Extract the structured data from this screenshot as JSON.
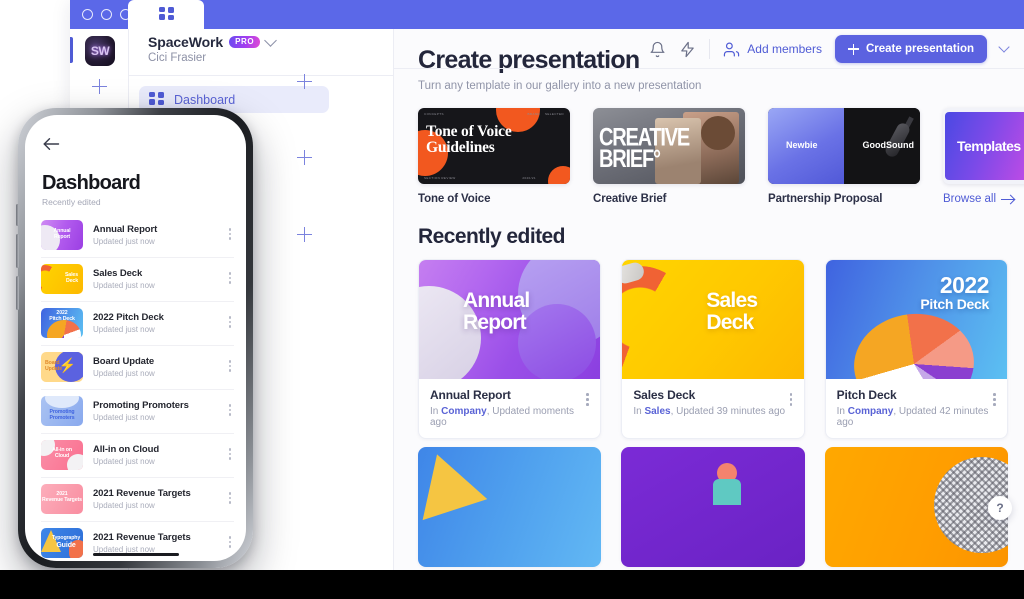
{
  "browser": {
    "tab_icon": "grid-icon",
    "traffic_lights": [
      "close",
      "minimize",
      "maximize"
    ]
  },
  "workspace": {
    "avatar_initials": "SW",
    "name": "SpaceWork",
    "plan_badge": "PRO",
    "user": "Cici Frasier",
    "chevron_icon": "chevron-down-icon",
    "rail_add_icon": "plus-icon",
    "sidebar_add_icon": "plus-icon"
  },
  "sidebar": {
    "items": [
      {
        "label": "Dashboard",
        "icon": "grid-icon",
        "active": true
      }
    ]
  },
  "appbar": {
    "notifications_icon": "bell-icon",
    "activity_icon": "lightning-icon",
    "add_members_icon": "people-icon",
    "add_members_label": "Add members",
    "create_label": "Create presentation",
    "create_plus_icon": "plus-icon",
    "create_chevron_icon": "chevron-down-icon",
    "accent": "#5b62e0"
  },
  "main": {
    "title": "Create presentation",
    "subtitle": "Turn any template in our gallery into a new presentation",
    "templates": [
      {
        "name": "Tone of Voice",
        "art": "tone-of-voice",
        "thumb_line1": "Tone of Voice",
        "thumb_line2": "Guidelines"
      },
      {
        "name": "Creative Brief",
        "art": "creative-brief",
        "thumb_line1": "CREATIVE",
        "thumb_line2": "BRIEF°"
      },
      {
        "name": "Partnership Proposal",
        "art": "partnership",
        "thumb_line1": "Newbie",
        "thumb_line2": "GoodSound"
      },
      {
        "name": "Browse all",
        "art": "templates-stack",
        "thumb_line1": "Templates",
        "is_link": true,
        "arrow_icon": "arrow-right-icon"
      }
    ],
    "recent_title": "Recently edited",
    "recent_cards": [
      {
        "title": "Annual Report",
        "meta_prefix": "In ",
        "meta_folder": "Company",
        "meta_suffix": ", Updated moments ago",
        "thumb_line1": "Annual",
        "thumb_line2": "Report",
        "art": "annual-report",
        "menu_icon": "kebab-menu-icon"
      },
      {
        "title": "Sales Deck",
        "meta_prefix": "In ",
        "meta_folder": "Sales",
        "meta_suffix": ", Updated 39 minutes ago",
        "thumb_line1": "Sales",
        "thumb_line2": "Deck",
        "art": "sales-deck",
        "menu_icon": "kebab-menu-icon"
      },
      {
        "title": "Pitch Deck",
        "meta_prefix": "In ",
        "meta_folder": "Company",
        "meta_suffix": ", Updated 42 minutes ago",
        "thumb_line1": "2022",
        "thumb_line2": "Pitch Deck",
        "art": "pitch-deck",
        "menu_icon": "kebab-menu-icon"
      }
    ],
    "recent_cards_row2": [
      {
        "art": "typography-guide"
      },
      {
        "art": "purple-character"
      },
      {
        "art": "orange-sphere"
      }
    ],
    "help_label": "?"
  },
  "phone": {
    "back_icon": "arrow-left-icon",
    "title": "Dashboard",
    "subtitle": "Recently edited",
    "items": [
      {
        "name": "Annual Report",
        "meta": "Updated just now",
        "art": "ph-a",
        "thumb_label": "Annual\nReport",
        "menu_icon": "kebab-menu-icon"
      },
      {
        "name": "Sales Deck",
        "meta": "Updated just now",
        "art": "ph-b",
        "thumb_label": "Sales\nDeck",
        "menu_icon": "kebab-menu-icon"
      },
      {
        "name": "2022 Pitch Deck",
        "meta": "Updated just now",
        "art": "ph-c",
        "thumb_label": "2022\nPitch Deck",
        "menu_icon": "kebab-menu-icon"
      },
      {
        "name": "Board Update",
        "meta": "Updated just now",
        "art": "ph-d",
        "thumb_label": "Board\nUpdate",
        "menu_icon": "kebab-menu-icon"
      },
      {
        "name": "Promoting Promoters",
        "meta": "Updated just now",
        "art": "ph-e",
        "thumb_label": "Promoting\nPromoters",
        "menu_icon": "kebab-menu-icon"
      },
      {
        "name": "All-in on Cloud",
        "meta": "Updated just now",
        "art": "ph-f",
        "thumb_label": "All-in on\nCloud",
        "menu_icon": "kebab-menu-icon"
      },
      {
        "name": "2021 Revenue Targets",
        "meta": "Updated just now",
        "art": "ph-g",
        "thumb_label": "2021\nRevenue Targets",
        "menu_icon": "kebab-menu-icon"
      },
      {
        "name": "2021 Revenue Targets",
        "meta": "Updated just now",
        "art": "ph-h",
        "thumb_label": "Typography\nGuide",
        "menu_icon": "kebab-menu-icon"
      }
    ]
  },
  "colors": {
    "brand_blue": "#5b68e8",
    "accent": "#4f5bd5",
    "bg": "#fbfbfd",
    "text": "#23263b",
    "muted": "#9094a8"
  }
}
